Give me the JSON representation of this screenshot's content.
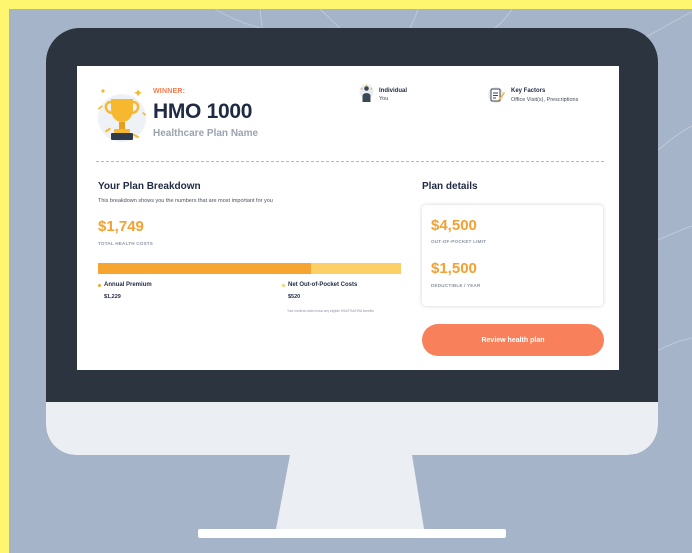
{
  "header": {
    "winner_label": "WINNER:",
    "plan_name": "HMO 1000",
    "plan_subtitle": "Healthcare Plan Name",
    "coverage": {
      "title": "Individual",
      "value": "You",
      "icon": "person-icon"
    },
    "key_factors": {
      "title": "Key Factors",
      "value": "Office Visit(s), Prescriptions",
      "icon": "clipboard-pencil-icon"
    }
  },
  "breakdown": {
    "title": "Your Plan Breakdown",
    "description": "This breakdown shows you the numbers that are most important for you",
    "total_amount": "$1,749",
    "total_label": "TOTAL HEALTH COSTS",
    "bar_premium_fraction": 0.703,
    "premium": {
      "label": "Annual Premium",
      "value": "$1,229"
    },
    "oop": {
      "label": "Net Out-of-Pocket Costs",
      "value": "$520"
    },
    "footnote": "Your medical costs minus any eligible HSA/FSA/HRA benefits"
  },
  "details": {
    "title": "Plan details",
    "oop_limit": {
      "amount": "$4,500",
      "label": "OUT-OF-POCKET LIMIT"
    },
    "deductible": {
      "amount": "$1,500",
      "label": "DEDUCTIBLE / YEAR"
    }
  },
  "actions": {
    "review_label": "Review health plan"
  },
  "colors": {
    "accent_orange": "#f47a4d",
    "amount_orange": "#f5a030",
    "bar_premium": "#f5a530",
    "bar_oop": "#fdd067",
    "button": "#f8805a",
    "navy": "#1f2a44"
  }
}
